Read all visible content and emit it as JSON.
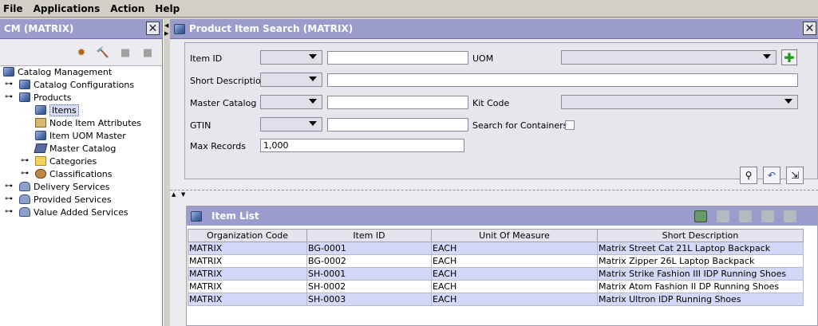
{
  "menu": [
    "File",
    "Applications",
    "Action",
    "Help"
  ],
  "left_panel": {
    "title": "CM (MATRIX)",
    "tree": [
      {
        "label": "Catalog Management",
        "icon": "cube-icon"
      },
      {
        "label": "Catalog Configurations",
        "icon": "cube-icon"
      },
      {
        "label": "Products",
        "icon": "cube-icon"
      },
      {
        "label": "Items",
        "icon": "cube-icon"
      },
      {
        "label": "Node Item Attributes",
        "icon": "box-icon"
      },
      {
        "label": "Item UOM Master",
        "icon": "uom-icon"
      },
      {
        "label": "Master Catalog",
        "icon": "book-icon"
      },
      {
        "label": "Categories",
        "icon": "folder-icon"
      },
      {
        "label": "Classifications",
        "icon": "gear-icon"
      },
      {
        "label": "Delivery Services",
        "icon": "person-icon"
      },
      {
        "label": "Provided Services",
        "icon": "person-icon"
      },
      {
        "label": "Value Added Services",
        "icon": "person-icon"
      }
    ]
  },
  "main": {
    "title": "Product Item Search (MATRIX)",
    "search": {
      "item_id_label": "Item ID",
      "uom_label": "UOM",
      "short_desc_label": "Short Description",
      "master_catalog_label": "Master Catalog",
      "kit_code_label": "Kit Code",
      "gtin_label": "GTIN",
      "search_containers_label": "Search for Containers",
      "max_records_label": "Max Records",
      "max_records_value": "1,000"
    },
    "item_list": {
      "title": "Item List",
      "columns": [
        "Organization Code",
        "Item ID",
        "Unit Of Measure",
        "Short Description"
      ],
      "rows": [
        [
          "MATRIX",
          "BG-0001",
          "EACH",
          "Matrix Street Cat 21L Laptop Backpack"
        ],
        [
          "MATRIX",
          "BG-0002",
          "EACH",
          "Matrix Zipper 26L Laptop Backpack"
        ],
        [
          "MATRIX",
          "SH-0001",
          "EACH",
          "Matrix Strike Fashion III IDP Running Shoes"
        ],
        [
          "MATRIX",
          "SH-0002",
          "EACH",
          "Matrix Atom Fashion II DP Running Shoes"
        ],
        [
          "MATRIX",
          "SH-0003",
          "EACH",
          "Matrix Ultron IDP Running Shoes"
        ]
      ]
    }
  },
  "colors": {
    "header": "#9c9ccc",
    "row_highlight": "#d4d8f8",
    "add_green": "#1a9a1a"
  }
}
